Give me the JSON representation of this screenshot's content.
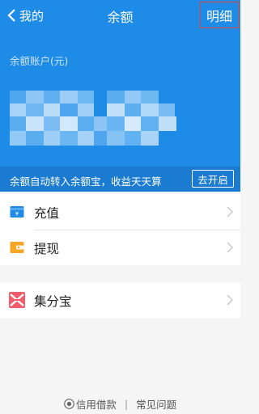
{
  "nav": {
    "back_label": "我的",
    "title": "余额",
    "detail_label": "明细"
  },
  "account": {
    "label": "余额账户(元)"
  },
  "banner": {
    "text": "余额自动转入余额宝，收益天天算",
    "button": "去开启"
  },
  "menu": {
    "recharge": "充值",
    "withdraw": "提现",
    "jifenbao": "集分宝"
  },
  "footer": {
    "credit": "信用借款",
    "separator": "|",
    "faq": "常见问题"
  },
  "colors": {
    "brand_blue": "#1e8be6",
    "banner_blue": "#1a7bd0",
    "highlight_border": "#e0453b"
  }
}
